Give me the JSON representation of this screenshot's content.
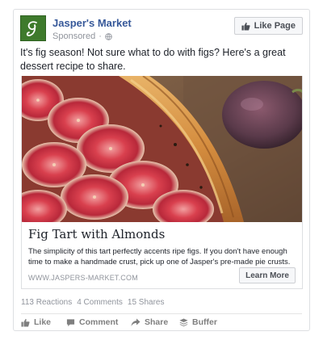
{
  "page": {
    "name": "Jasper's Market",
    "sponsored_label": "Sponsored",
    "like_page_label": "Like Page"
  },
  "post": {
    "text": "It's fig season! Not sure what to do with figs? Here's a great dessert recipe to share."
  },
  "link": {
    "title": "Fig Tart with Almonds",
    "description": "The simplicity of this tart perfectly accents ripe figs. If you don't have enough time to make a handmade crust, pick up one of Jasper's pre-made pie crusts.",
    "domain": "WWW.JASPERS-MARKET.COM",
    "cta_label": "Learn More"
  },
  "stats": {
    "reactions": "113 Reactions",
    "comments": "4 Comments",
    "shares": "15 Shares"
  },
  "actions": {
    "like": "Like",
    "comment": "Comment",
    "share": "Share",
    "buffer": "Buffer"
  },
  "colors": {
    "link_blue": "#365899",
    "logo_green": "#3e7a2c",
    "muted_gray": "#90949c"
  },
  "icons": {
    "logo": "jaspers-market-logo",
    "globe": "globe-icon",
    "like_page": "thumbs-up-icon",
    "like": "thumbs-up-icon",
    "comment": "comment-icon",
    "share": "share-icon",
    "buffer": "buffer-icon"
  }
}
